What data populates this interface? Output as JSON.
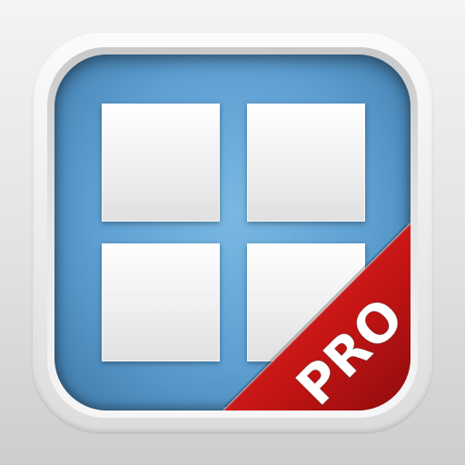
{
  "app_icon": {
    "badge_label": "PRO",
    "colors": {
      "background": "#e2e2e2",
      "panel": "#5d9fd2",
      "tile": "#f0f0f0",
      "ribbon": "#d01a1a",
      "badge_text": "#ffffff"
    },
    "icons": [
      "grid-2x2-icon"
    ]
  }
}
